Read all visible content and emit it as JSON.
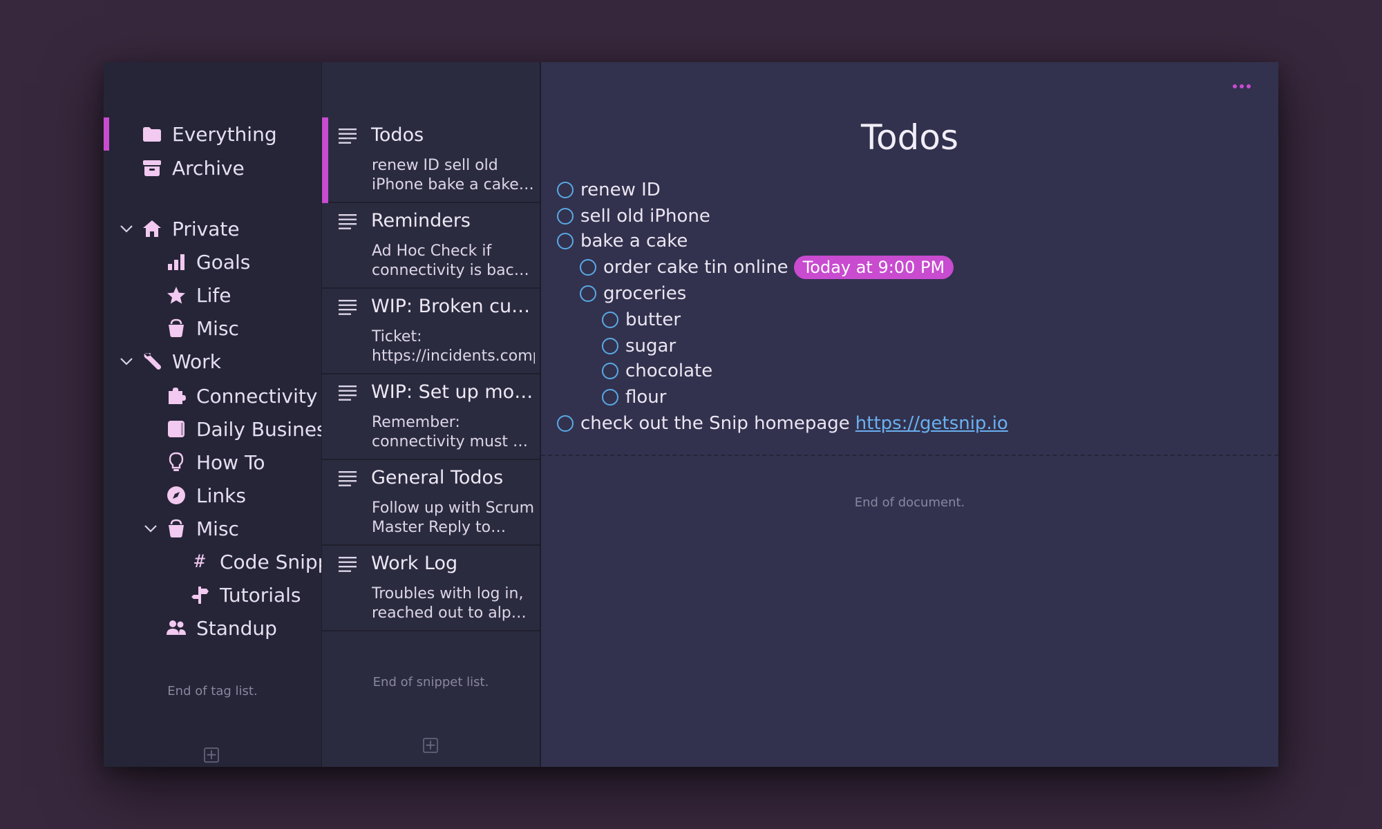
{
  "tags": {
    "items": [
      {
        "label": "Everything",
        "icon": "folder-icon",
        "selected": true
      },
      {
        "label": "Archive",
        "icon": "archive-icon"
      },
      {
        "label": "Private",
        "icon": "home-icon",
        "expanded": true
      },
      {
        "label": "Goals",
        "icon": "chart-bars-icon"
      },
      {
        "label": "Life",
        "icon": "star-icon"
      },
      {
        "label": "Misc",
        "icon": "bucket-icon"
      },
      {
        "label": "Work",
        "icon": "wrench-icon",
        "expanded": true
      },
      {
        "label": "Connectivity",
        "icon": "puzzle-icon"
      },
      {
        "label": "Daily Business",
        "icon": "calendar-icon"
      },
      {
        "label": "How To",
        "icon": "lightbulb-icon"
      },
      {
        "label": "Links",
        "icon": "compass-icon"
      },
      {
        "label": "Misc",
        "icon": "bucket-icon",
        "expanded": true
      },
      {
        "label": "Code Snippets",
        "icon": "hash-icon"
      },
      {
        "label": "Tutorials",
        "icon": "signpost-icon"
      },
      {
        "label": "Standup",
        "icon": "users-icon"
      }
    ],
    "end_text": "End of tag list."
  },
  "snippets": {
    "items": [
      {
        "title": "Todos",
        "preview": "renew ID sell old iPhone bake a cake order cake tin online",
        "selected": true
      },
      {
        "title": "Reminders",
        "preview": "Ad Hoc Check if connectivity is back up"
      },
      {
        "title": "WIP: Broken customer connection",
        "preview": "Ticket: https://incidents.company.com"
      },
      {
        "title": "WIP: Set up monitoring",
        "preview": "Remember: connectivity must be checked"
      },
      {
        "title": "General Todos",
        "preview": "Follow up with Scrum Master Reply to emails"
      },
      {
        "title": "Work Log",
        "preview": "Troubles with log in, reached out to alpha team"
      }
    ],
    "end_text": "End of snippet list."
  },
  "document": {
    "title": "Todos",
    "todos": [
      {
        "text": "renew ID"
      },
      {
        "text": "sell old iPhone"
      },
      {
        "text": "bake a cake"
      },
      {
        "text": "order cake tin online",
        "due": "Today at 9:00 PM"
      },
      {
        "text": "groceries"
      },
      {
        "text": "butter"
      },
      {
        "text": "sugar"
      },
      {
        "text": "chocolate"
      },
      {
        "text": "flour"
      },
      {
        "text": "check out the Snip homepage",
        "link": "https://getsnip.io"
      }
    ],
    "end_text": "End of document."
  },
  "colors": {
    "accent": "#c84bd0",
    "checkbox": "#5aa9e6",
    "link": "#6ab0f0"
  }
}
